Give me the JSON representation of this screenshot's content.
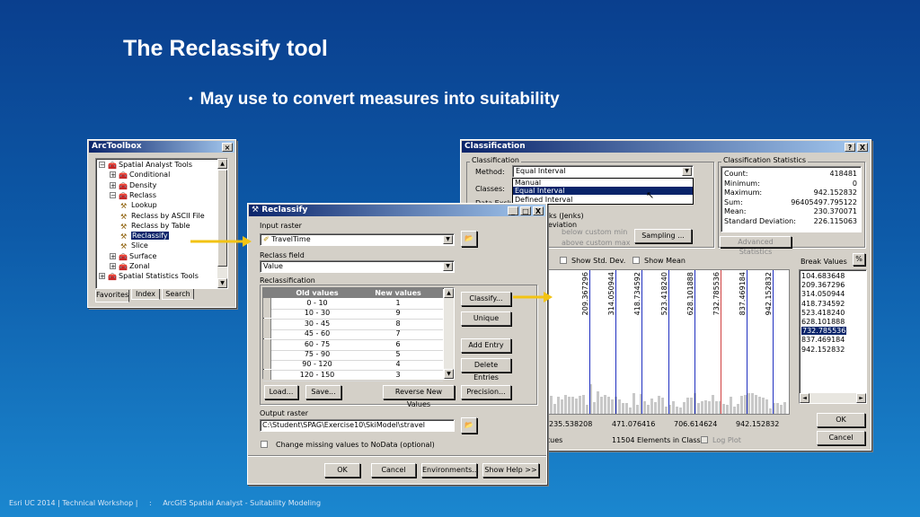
{
  "slide": {
    "title": "The Reclassify tool",
    "bullet": "May use to convert measures into suitability",
    "footer": [
      "Esri UC 2014 | Technical Workshop |",
      ":",
      "ArcGIS Spatial Analyst - Suitability Modeling"
    ]
  },
  "arctoolbox": {
    "title": "ArcToolbox",
    "tree": [
      {
        "label": "Spatial Analyst Tools",
        "level": 0,
        "sign": "−"
      },
      {
        "label": "Conditional",
        "level": 1,
        "sign": "+"
      },
      {
        "label": "Density",
        "level": 1,
        "sign": "+"
      },
      {
        "label": "Reclass",
        "level": 1,
        "sign": "−"
      },
      {
        "label": "Lookup",
        "level": 2
      },
      {
        "label": "Reclass by ASCII File",
        "level": 2
      },
      {
        "label": "Reclass by Table",
        "level": 2
      },
      {
        "label": "Reclassify",
        "level": 2,
        "selected": true
      },
      {
        "label": "Slice",
        "level": 2
      },
      {
        "label": "Surface",
        "level": 1,
        "sign": "+"
      },
      {
        "label": "Zonal",
        "level": 1,
        "sign": "+"
      },
      {
        "label": "Spatial Statistics Tools",
        "level": 0,
        "sign": "+"
      }
    ],
    "tabs": [
      "Favorites",
      "Index",
      "Search"
    ]
  },
  "reclassify": {
    "title": "Reclassify",
    "input_raster_label": "Input raster",
    "input_raster_value": "TravelTime",
    "reclass_field_label": "Reclass field",
    "reclass_field_value": "Value",
    "reclassification_label": "Reclassification",
    "table_headers": [
      "Old values",
      "New values"
    ],
    "table_rows": [
      [
        "0 - 10",
        "1"
      ],
      [
        "10 - 30",
        "9"
      ],
      [
        "30 - 45",
        "8"
      ],
      [
        "45 - 60",
        "7"
      ],
      [
        "60 - 75",
        "6"
      ],
      [
        "75 - 90",
        "5"
      ],
      [
        "90 - 120",
        "4"
      ],
      [
        "120 - 150",
        "3"
      ]
    ],
    "side_buttons": [
      "Classify...",
      "Unique",
      "Add Entry",
      "Delete Entries"
    ],
    "bottom_buttons": [
      "Load...",
      "Save...",
      "Reverse New Values",
      "Precision..."
    ],
    "output_raster_label": "Output raster",
    "output_raster_value": "C:\\Student\\SPAG\\Exercise10\\SkiModel\\stravel",
    "nodata_label": "Change missing values to NoData (optional)",
    "footer_buttons": [
      "OK",
      "Cancel",
      "Environments...",
      "Show Help >>"
    ],
    "controls": [
      "_",
      "□",
      "X"
    ]
  },
  "classification": {
    "title": "Classification",
    "controls": [
      "?",
      "X"
    ],
    "group_classification": "Classification",
    "method_label": "Method:",
    "method_value": "Equal Interval",
    "classes_label": "Classes:",
    "data_excl_label": "Data Exclusi",
    "method_options": [
      "Manual",
      "Equal Interval",
      "Defined Interval"
    ],
    "method_selected_index": 1,
    "obscured_option": "aks (Jenks)",
    "obscured_option2": "eviation",
    "show_custom_min": "below custom min",
    "show_custom_max": "above custom max",
    "sampling_button": "Sampling ...",
    "stats_title": "Classification Statistics",
    "stats": [
      {
        "label": "Count:",
        "value": "418481"
      },
      {
        "label": "Minimum:",
        "value": "0"
      },
      {
        "label": "Maximum:",
        "value": "942.152832"
      },
      {
        "label": "Sum:",
        "value": "96405497.795122"
      },
      {
        "label": "Mean:",
        "value": "230.370071"
      },
      {
        "label": "Standard Deviation:",
        "value": "226.115063"
      }
    ],
    "advanced_stats_button": "Advanced Statistics",
    "show_std_dev": "Show Std. Dev.",
    "show_mean": "Show Mean",
    "break_values_label": "Break Values",
    "break_values": [
      "104.683648",
      "209.367296",
      "314.050944",
      "418.734592",
      "523.418240",
      "628.101888",
      "732.785536",
      "837.469184",
      "942.152832"
    ],
    "break_selected_index": 6,
    "histogram_labels_visible": [
      "209.367296",
      "314.050944",
      "418.734592",
      "523.418240",
      "628.101888",
      "732.785536",
      "837.469184",
      "942.152832"
    ],
    "axis_ticks": [
      "235.538208",
      "471.076416",
      "706.614624",
      "942.152832"
    ],
    "elements_in_class": "11504 Elements in Class",
    "log_plot": "Log Plot",
    "partial_label": "tues",
    "ok": "OK",
    "cancel": "Cancel",
    "pct_icon": "%"
  },
  "colors": {
    "titlebar_start": "#0a246a",
    "titlebar_end": "#a6caf0",
    "arrow": "#f2c313",
    "break_line": "#2030c0",
    "selected_break_line": "#d04040"
  }
}
